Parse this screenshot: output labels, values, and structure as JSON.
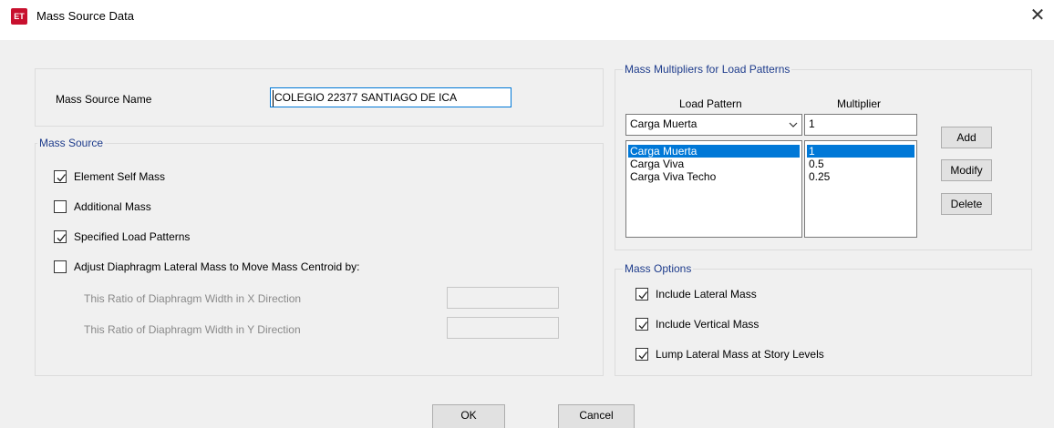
{
  "window": {
    "title": "Mass Source Data",
    "icon_text": "ET",
    "close_glyph": "✕"
  },
  "mass_source_name": {
    "label": "Mass Source Name",
    "value": "COLEGIO 22377 SANTIAGO DE ICA"
  },
  "mass_source": {
    "legend": "Mass Source",
    "element_self_mass": {
      "label": "Element Self Mass",
      "checked": true
    },
    "additional_mass": {
      "label": "Additional Mass",
      "checked": false
    },
    "specified_load_patterns": {
      "label": "Specified Load Patterns",
      "checked": true
    },
    "adjust_diaphragm": {
      "label": "Adjust Diaphragm Lateral Mass to Move Mass Centroid by:",
      "checked": false
    },
    "ratio_x_label": "This Ratio of Diaphragm Width in X Direction",
    "ratio_x_value": "",
    "ratio_y_label": "This Ratio of Diaphragm Width in Y Direction",
    "ratio_y_value": ""
  },
  "multipliers": {
    "legend": "Mass Multipliers for Load Patterns",
    "col_load_pattern": "Load Pattern",
    "col_multiplier": "Multiplier",
    "selected_pattern": "Carga Muerta",
    "multiplier_value": "1",
    "patterns": [
      "Carga Muerta",
      "Carga Viva",
      "Carga Viva Techo"
    ],
    "values": [
      "1",
      "0.5",
      "0.25"
    ],
    "add_label": "Add",
    "modify_label": "Modify",
    "delete_label": "Delete"
  },
  "mass_options": {
    "legend": "Mass Options",
    "include_lateral": {
      "label": "Include Lateral Mass",
      "checked": true
    },
    "include_vertical": {
      "label": "Include Vertical Mass",
      "checked": true
    },
    "lump_lateral": {
      "label": "Lump Lateral Mass at Story Levels",
      "checked": true
    }
  },
  "buttons": {
    "ok": "OK",
    "cancel": "Cancel"
  }
}
